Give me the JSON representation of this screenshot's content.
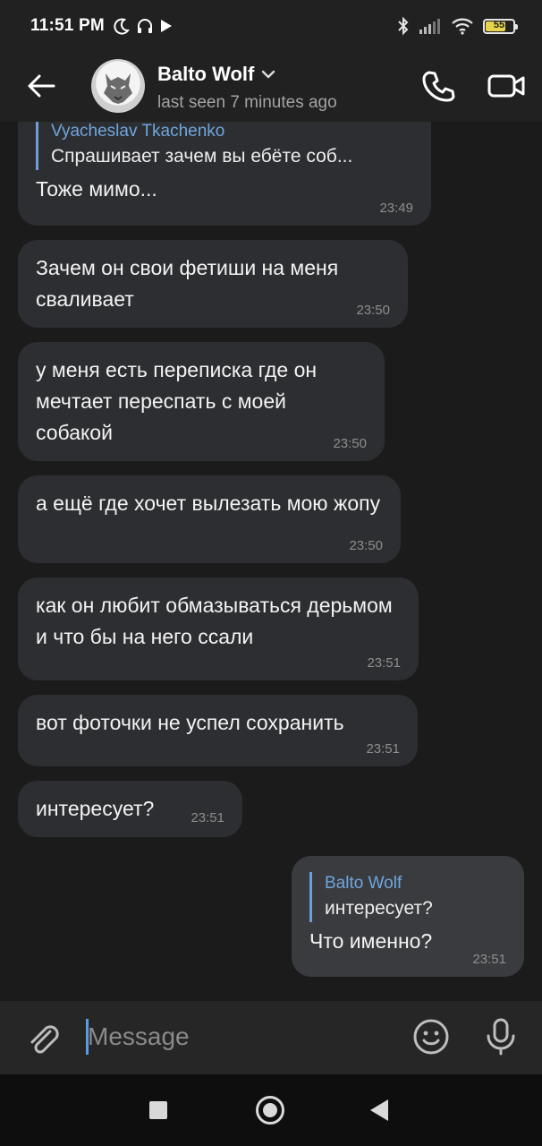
{
  "status_bar": {
    "time": "11:51 PM",
    "left_icons": [
      "moon-icon",
      "headset-icon",
      "play-icon"
    ],
    "right_icons": [
      "bluetooth-icon",
      "signal-icon",
      "wifi-icon",
      "battery-icon"
    ],
    "battery_level": "55"
  },
  "header": {
    "contact_name": "Balto Wolf",
    "last_seen": "last seen 7 minutes ago",
    "avatar_text": "Balto Wolf"
  },
  "messages": [
    {
      "direction": "in",
      "reply_to_name": "Vyacheslav Tkachenko",
      "reply_to_text": "Спрашивает зачем вы ебёте соб...",
      "text": "Тоже мимо...",
      "time": "23:49"
    },
    {
      "direction": "in",
      "text": "Зачем он свои фетиши на меня сваливает",
      "time": "23:50"
    },
    {
      "direction": "in",
      "text": "у меня есть переписка где он мечтает переспать с моей собакой",
      "time": "23:50"
    },
    {
      "direction": "in",
      "text": "а ещё где хочет вылезать мою жопу",
      "time": "23:50"
    },
    {
      "direction": "in",
      "text": "как он любит обмазываться дерьмом и что бы на него ссали",
      "time": "23:51"
    },
    {
      "direction": "in",
      "text": "вот фоточки не успел сохранить",
      "time": "23:51"
    },
    {
      "direction": "in",
      "text": "интересует?",
      "time": "23:51"
    },
    {
      "direction": "out",
      "reply_to_name": "Balto Wolf",
      "reply_to_text": "интересует?",
      "text": "Что именно?",
      "time": "23:51"
    }
  ],
  "composer": {
    "placeholder": "Message"
  },
  "colors": {
    "background": "#1b1b1c",
    "bubble_in": "#2d2e31",
    "bubble_out": "#3a3b3e",
    "accent": "#6fa6df"
  }
}
